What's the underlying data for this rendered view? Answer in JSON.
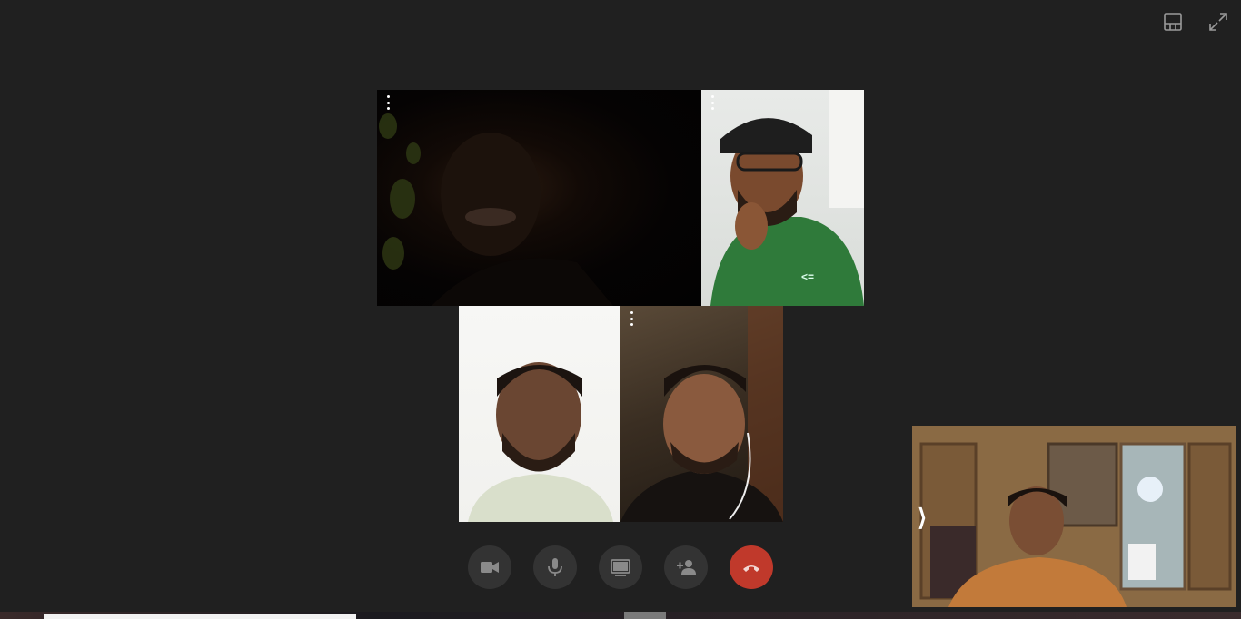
{
  "window": {
    "layout_icon": "layout-icon",
    "fullscreen_icon": "fullscreen-icon"
  },
  "tiles": [
    {
      "name": "participant-1",
      "menu_icon": "more-vert-icon"
    },
    {
      "name": "participant-2",
      "menu_icon": "more-vert-icon"
    },
    {
      "name": "participant-3",
      "menu_icon": null
    },
    {
      "name": "participant-4",
      "menu_icon": "more-vert-icon"
    }
  ],
  "controls": [
    {
      "name": "camera-button",
      "icon": "videocam-icon"
    },
    {
      "name": "mic-button",
      "icon": "mic-icon"
    },
    {
      "name": "screen-share-button",
      "icon": "screen-share-icon"
    },
    {
      "name": "add-person-button",
      "icon": "person-add-icon"
    },
    {
      "name": "end-call-button",
      "icon": "call-end-icon",
      "color": "#c0392b"
    }
  ],
  "self_view": {
    "expand_glyph": "⟩"
  },
  "colors": {
    "background": "#202020",
    "control_bg": "#333333",
    "end_call": "#c0392b"
  }
}
